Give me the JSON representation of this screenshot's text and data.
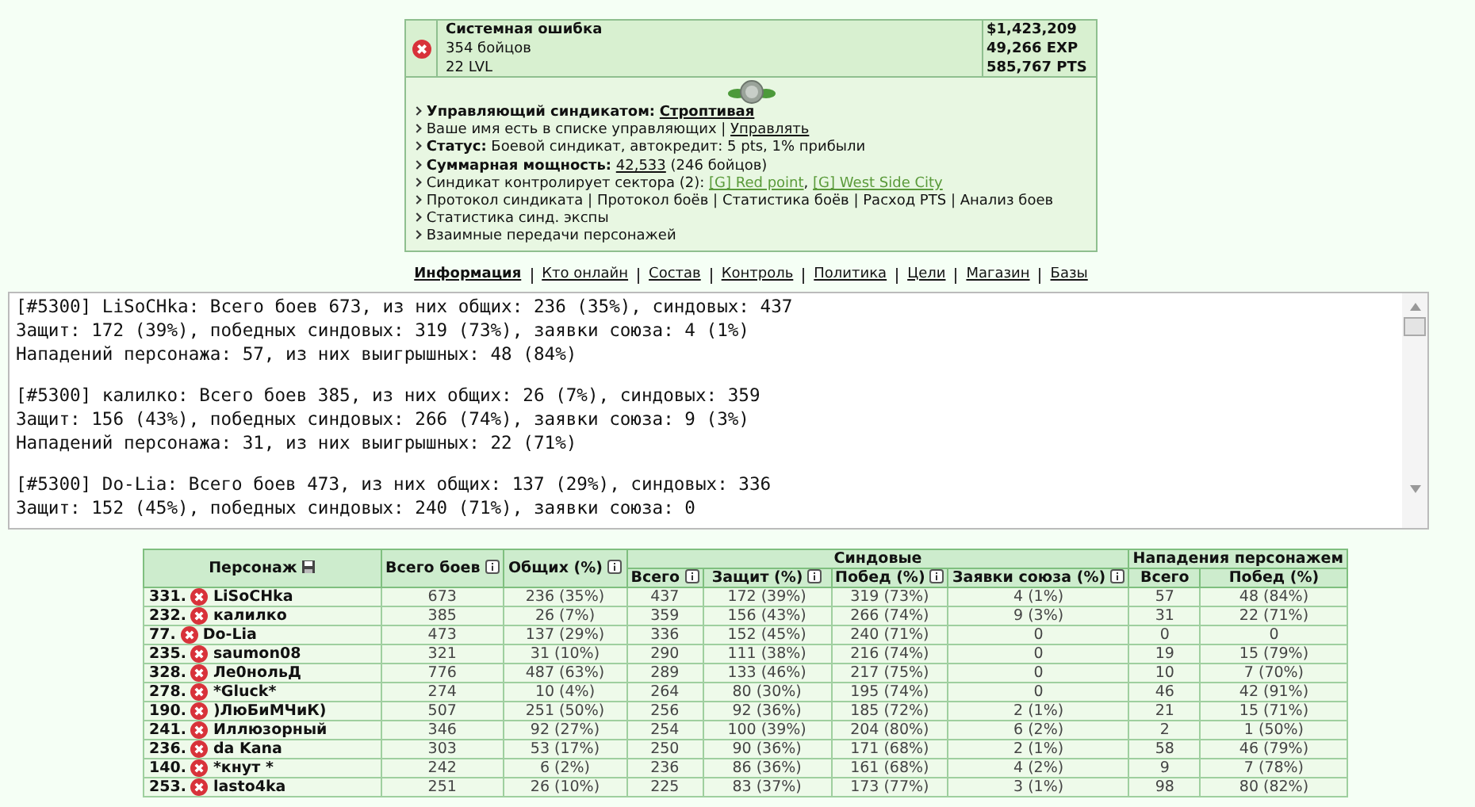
{
  "syndicate": {
    "name": "Системная ошибка",
    "members": "354 бойцов",
    "level": "22 LVL",
    "stats": [
      "$1,423,209",
      "49,266 EXP",
      "585,767 PTS"
    ]
  },
  "info_lines": [
    [
      {
        "kind": "bold",
        "text": "Управляющий синдикатом:"
      },
      {
        "kind": "link",
        "text": "Строптивая",
        "bold": true
      }
    ],
    [
      {
        "kind": "text",
        "text": "Ваше имя есть в списке управляющих |"
      },
      {
        "kind": "link",
        "text": "Управлять"
      }
    ],
    [
      {
        "kind": "bold",
        "text": "Статус:"
      },
      {
        "kind": "text",
        "text": "Боевой синдикат, автокредит: 5 pts, 1% прибыли"
      }
    ],
    [
      {
        "kind": "bold",
        "text": "Суммарная мощность:"
      },
      {
        "kind": "link",
        "text": "42,533"
      },
      {
        "kind": "text",
        "text": "(246 бойцов)"
      }
    ],
    [
      {
        "kind": "text",
        "text": "Синдикат контролирует сектора (2):"
      },
      {
        "kind": "sector",
        "text": "[G] Red point"
      },
      {
        "kind": "punct",
        "text": ","
      },
      {
        "kind": "sector",
        "text": "[G] West Side City"
      }
    ],
    [
      {
        "kind": "plain_link",
        "text": "Протокол синдиката"
      },
      {
        "kind": "text",
        "text": "|"
      },
      {
        "kind": "plain_link",
        "text": "Протокол боёв"
      },
      {
        "kind": "text",
        "text": "|"
      },
      {
        "kind": "plain_link",
        "text": "Статистика боёв"
      },
      {
        "kind": "text",
        "text": "|"
      },
      {
        "kind": "plain_link",
        "text": "Расход PTS"
      },
      {
        "kind": "text",
        "text": "|"
      },
      {
        "kind": "plain_link",
        "text": "Анализ боев"
      }
    ],
    [
      {
        "kind": "plain_link",
        "text": "Статистика синд. экспы"
      }
    ],
    [
      {
        "kind": "plain_link",
        "text": "Взаимные передачи персонажей"
      }
    ]
  ],
  "nav": [
    {
      "label": "Информация",
      "selected": true
    },
    {
      "label": "Кто онлайн",
      "selected": false
    },
    {
      "label": "Состав",
      "selected": false
    },
    {
      "label": "Контроль",
      "selected": false
    },
    {
      "label": "Политика",
      "selected": false
    },
    {
      "label": "Цели",
      "selected": false
    },
    {
      "label": "Магазин",
      "selected": false
    },
    {
      "label": "Базы",
      "selected": false
    }
  ],
  "log": [
    [
      "[#5300] LiSoCHka: Всего боев 673, из них общих: 236 (35%), синдовых: 437",
      "Защит: 172 (39%), победных синдовых: 319 (73%), заявки союза: 4 (1%)",
      "Нападений персонажа: 57, из них выигрышных: 48 (84%)"
    ],
    [
      "[#5300] калилко: Всего боев 385, из них общих: 26 (7%), синдовых: 359",
      "Защит: 156 (43%), победных синдовых: 266 (74%), заявки союза: 9 (3%)",
      "Нападений персонажа: 31, из них выигрышных: 22 (71%)"
    ],
    [
      "[#5300] Do-Lia: Всего боев 473, из них общих: 137 (29%), синдовых: 336",
      "Защит: 152 (45%), победных синдовых: 240 (71%), заявки союза: 0"
    ]
  ],
  "table": {
    "column_groups": [
      "Синдовые",
      "Нападения персонажем"
    ],
    "columns": [
      "Персонаж",
      "Всего боев",
      "Общих (%)",
      "Всего",
      "Защит (%)",
      "Побед (%)",
      "Заявки союза (%)",
      "Всего",
      "Побед (%)"
    ],
    "rows": [
      {
        "cells": [
          {
            "rank": "331.",
            "name": "LiSoCHka"
          },
          "673",
          "236 (35%)",
          "437",
          "172 (39%)",
          "319 (73%)",
          "4 (1%)",
          "57",
          "48 (84%)"
        ]
      },
      {
        "cells": [
          {
            "rank": "232.",
            "name": "калилко"
          },
          "385",
          "26 (7%)",
          "359",
          "156 (43%)",
          "266 (74%)",
          "9 (3%)",
          "31",
          "22 (71%)"
        ]
      },
      {
        "cells": [
          {
            "rank": "77.",
            "name": "Do-Lia"
          },
          "473",
          "137 (29%)",
          "336",
          "152 (45%)",
          "240 (71%)",
          "0",
          "0",
          "0"
        ]
      },
      {
        "cells": [
          {
            "rank": "235.",
            "name": "saumon08"
          },
          "321",
          "31 (10%)",
          "290",
          "111 (38%)",
          "216 (74%)",
          "0",
          "19",
          "15 (79%)"
        ]
      },
      {
        "cells": [
          {
            "rank": "328.",
            "name": "Ле0нольД"
          },
          "776",
          "487 (63%)",
          "289",
          "133 (46%)",
          "217 (75%)",
          "0",
          "10",
          "7 (70%)"
        ]
      },
      {
        "cells": [
          {
            "rank": "278.",
            "name": "*Gluck*"
          },
          "274",
          "10 (4%)",
          "264",
          "80 (30%)",
          "195 (74%)",
          "0",
          "46",
          "42 (91%)"
        ]
      },
      {
        "cells": [
          {
            "rank": "190.",
            "name": ")ЛюБиМЧиК)"
          },
          "507",
          "251 (50%)",
          "256",
          "92 (36%)",
          "185 (72%)",
          "2 (1%)",
          "21",
          "15 (71%)"
        ]
      },
      {
        "cells": [
          {
            "rank": "241.",
            "name": "Иллюзорный"
          },
          "346",
          "92 (27%)",
          "254",
          "100 (39%)",
          "204 (80%)",
          "6 (2%)",
          "2",
          "1 (50%)"
        ]
      },
      {
        "cells": [
          {
            "rank": "236.",
            "name": "da Kana"
          },
          "303",
          "53 (17%)",
          "250",
          "90 (36%)",
          "171 (68%)",
          "2 (1%)",
          "58",
          "46 (79%)"
        ]
      },
      {
        "cells": [
          {
            "rank": "140.",
            "name": "*кнут *"
          },
          "242",
          "6 (2%)",
          "236",
          "86 (36%)",
          "161 (68%)",
          "4 (2%)",
          "9",
          "7 (78%)"
        ]
      },
      {
        "cells": [
          {
            "rank": "253.",
            "name": "lasto4ka"
          },
          "251",
          "26 (10%)",
          "225",
          "83 (37%)",
          "173 (77%)",
          "3 (1%)",
          "98",
          "80 (82%)"
        ]
      }
    ]
  }
}
